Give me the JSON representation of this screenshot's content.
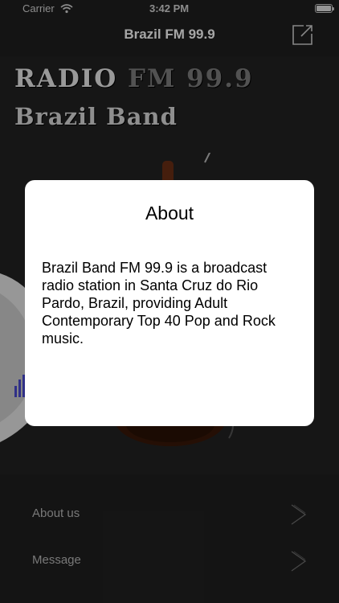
{
  "status_bar": {
    "carrier": "Carrier",
    "time": "3:42 PM",
    "wifi_icon": "wifi-icon",
    "battery_icon": "battery-icon"
  },
  "nav": {
    "title": "Brazil FM 99.9",
    "share_icon": "share-icon"
  },
  "artwork": {
    "line1_radio": "RADIO",
    "line1_fm": "FM 99.9",
    "line2": "Brazil Band"
  },
  "menu": [
    {
      "label": "About us",
      "icon": "chevron-right-icon"
    },
    {
      "label": "Message",
      "icon": "chevron-right-icon"
    }
  ],
  "dialog": {
    "title": "About",
    "body": "Brazil Band FM 99.9 is a broadcast radio station in Santa Cruz do Rio Pardo, Brazil, providing Adult Contemporary Top 40 Pop and Rock music."
  },
  "colors": {
    "background": "#202020",
    "dialog_background": "#ffffff",
    "menu_text": "#b9b9b9"
  }
}
